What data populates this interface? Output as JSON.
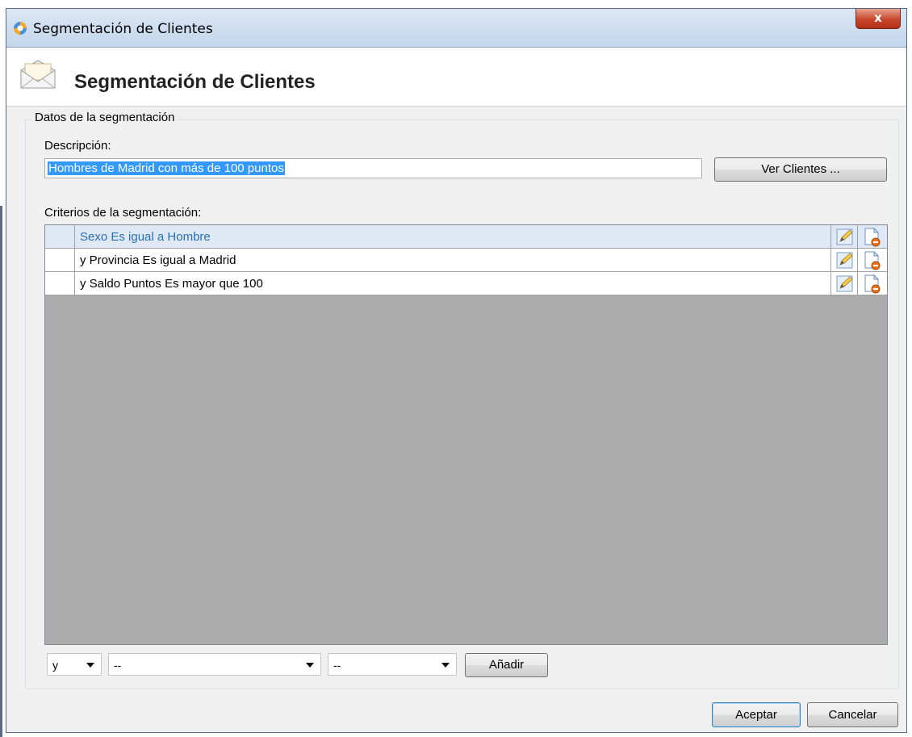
{
  "window": {
    "title": "Segmentación de Clientes",
    "close_label": "x"
  },
  "header": {
    "title": "Segmentación de Clientes"
  },
  "group": {
    "legend": "Datos de la segmentación",
    "description_label": "Descripción:",
    "description_value": "Hombres de Madrid con más de 100 puntos",
    "view_clients_label": "Ver Clientes ...",
    "criteria_label": "Criterios de la segmentación:"
  },
  "criteria": [
    {
      "text": "Sexo Es igual a Hombre",
      "selected": true
    },
    {
      "text": "y Provincia Es igual a Madrid",
      "selected": false
    },
    {
      "text": "y Saldo Puntos Es mayor que 100",
      "selected": false
    }
  ],
  "add_bar": {
    "connector_value": "y",
    "field_value": "--",
    "operator_value": "--",
    "add_label": "Añadir"
  },
  "footer": {
    "accept_label": "Aceptar",
    "cancel_label": "Cancelar"
  },
  "icons": {
    "edit": "pencil-edit-icon",
    "delete": "document-delete-icon",
    "app": "app-logo-icon",
    "header": "envelope-icon"
  }
}
